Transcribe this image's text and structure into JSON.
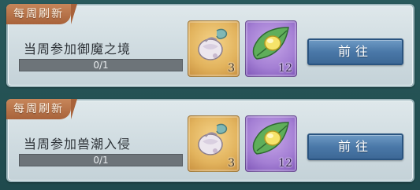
{
  "quests": [
    {
      "tag": "每周刷新",
      "title": "当周参加御魔之境",
      "progress_text": "0/1",
      "progress_fraction": 0,
      "rewards": [
        {
          "icon": "pouch-icon",
          "qty": "3"
        },
        {
          "icon": "leaf-egg-icon",
          "qty": "12"
        }
      ],
      "button_label": "前往"
    },
    {
      "tag": "每周刷新",
      "title": "当周参加兽潮入侵",
      "progress_text": "0/1",
      "progress_fraction": 0,
      "rewards": [
        {
          "icon": "pouch-icon",
          "qty": "3"
        },
        {
          "icon": "leaf-egg-icon",
          "qty": "12"
        }
      ],
      "button_label": "前往"
    }
  ],
  "colors": {
    "tag_bg": "#b06c43",
    "button_bg": "#4a78a8",
    "gold_slot": "#e2b35d",
    "purple_slot": "#a47fd4"
  }
}
